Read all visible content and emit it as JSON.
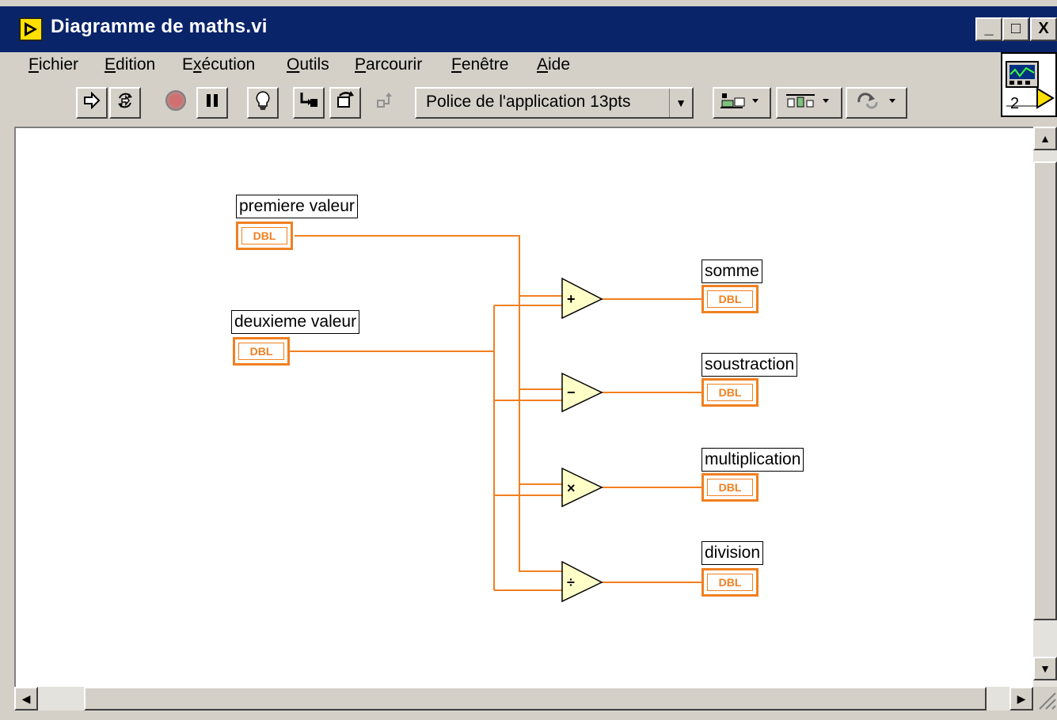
{
  "window": {
    "title": "Diagramme de maths.vi"
  },
  "title_buttons": {
    "minimize": "_",
    "maximize": "□",
    "close": "X"
  },
  "menu": [
    "Fichier",
    "Edition",
    "Exécution",
    "Outils",
    "Parcourir",
    "Fenêtre",
    "Aide"
  ],
  "menu_mnemonics": [
    "F",
    "E",
    "x",
    "O",
    "P",
    "F",
    "A"
  ],
  "toolbar": {
    "font_ring": "Police de l'application 13pts",
    "buttons": [
      "run-icon",
      "run-continuously-icon",
      "abort-icon",
      "pause-icon",
      "highlight-execution-icon",
      "step-into-icon",
      "step-over-icon",
      "step-out-icon",
      "align-objects-icon",
      "distribute-objects-icon",
      "reorder-icon"
    ]
  },
  "connector_pane": {
    "label": "2"
  },
  "diagram": {
    "controls": [
      {
        "label": "premiere valeur",
        "type": "DBL"
      },
      {
        "label": "deuxieme valeur",
        "type": "DBL"
      }
    ],
    "functions": [
      {
        "name": "add",
        "symbol": "+"
      },
      {
        "name": "subtract",
        "symbol": "−"
      },
      {
        "name": "multiply",
        "symbol": "×"
      },
      {
        "name": "divide",
        "symbol": "÷"
      }
    ],
    "indicators": [
      {
        "label": "somme",
        "type": "DBL"
      },
      {
        "label": "soustraction",
        "type": "DBL"
      },
      {
        "label": "multiplication",
        "type": "DBL"
      },
      {
        "label": "division",
        "type": "DBL"
      }
    ],
    "wire_color": "#f08020"
  }
}
